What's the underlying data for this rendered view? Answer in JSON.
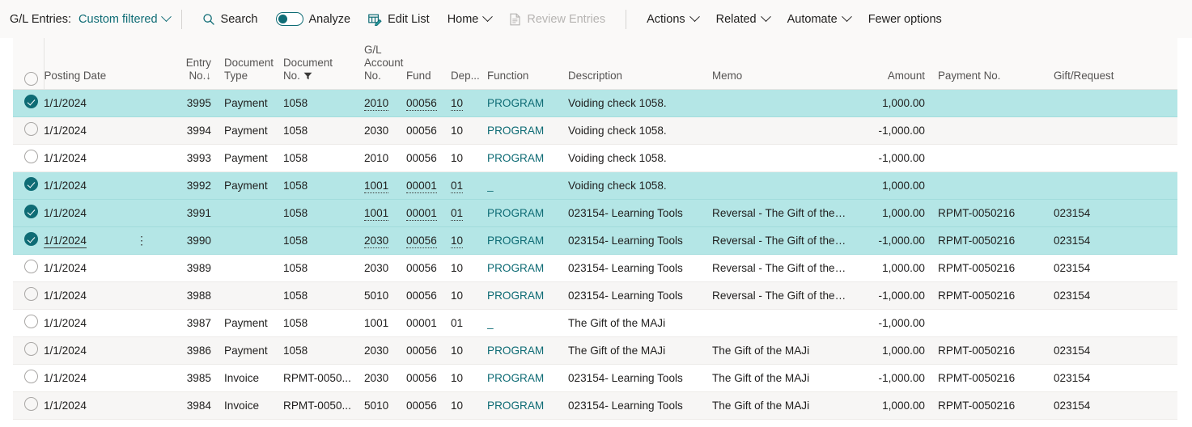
{
  "toolbar": {
    "page_label": "G/L Entries:",
    "filter_label": "Custom filtered",
    "search_label": "Search",
    "analyze_label": "Analyze",
    "analyze_toggle_state": "off",
    "edit_list_label": "Edit List",
    "home_label": "Home",
    "review_entries_label": "Review Entries",
    "review_entries_state": "disabled",
    "actions_label": "Actions",
    "related_label": "Related",
    "automate_label": "Automate",
    "fewer_options_label": "Fewer options",
    "accent_color": "#0f6c75",
    "bar_background": "#faf9f8"
  },
  "table": {
    "selection_color": "#b4e6e6",
    "sort_column": "Entry No.",
    "sort_direction": "descending",
    "filter_column": "Document No.",
    "columns": [
      {
        "key": "posting_date",
        "label": "Posting Date"
      },
      {
        "key": "entry_no",
        "label": "Entry No.",
        "sort_glyph": "↓"
      },
      {
        "key": "document_type",
        "label": "Document\nType"
      },
      {
        "key": "document_no",
        "label": "Document\nNo.",
        "filter_glyph": true
      },
      {
        "key": "gl_account_no",
        "label": "G/L\nAccount\nNo."
      },
      {
        "key": "fund",
        "label": "Fund"
      },
      {
        "key": "dep",
        "label": "Dep..."
      },
      {
        "key": "function",
        "label": "Function"
      },
      {
        "key": "description",
        "label": "Description"
      },
      {
        "key": "memo",
        "label": "Memo"
      },
      {
        "key": "amount",
        "label": "Amount"
      },
      {
        "key": "payment_no",
        "label": "Payment No."
      },
      {
        "key": "gift_request",
        "label": "Gift/Request"
      }
    ],
    "rows": [
      {
        "selected": true,
        "active": false,
        "posting_date": "1/1/2024",
        "entry_no": "3995",
        "document_type": "Payment",
        "document_no": "1058",
        "gl_account_no": "2010",
        "fund": "00056",
        "dep": "10",
        "function": "PROGRAM",
        "description": "Voiding check 1058.",
        "memo": "",
        "amount": "1,000.00",
        "payment_no": "",
        "gift_request": ""
      },
      {
        "selected": false,
        "active": false,
        "posting_date": "1/1/2024",
        "entry_no": "3994",
        "document_type": "Payment",
        "document_no": "1058",
        "gl_account_no": "2030",
        "fund": "00056",
        "dep": "10",
        "function": "PROGRAM",
        "description": "Voiding check 1058.",
        "memo": "",
        "amount": "-1,000.00",
        "payment_no": "",
        "gift_request": ""
      },
      {
        "selected": false,
        "active": false,
        "posting_date": "1/1/2024",
        "entry_no": "3993",
        "document_type": "Payment",
        "document_no": "1058",
        "gl_account_no": "2010",
        "fund": "00056",
        "dep": "10",
        "function": "PROGRAM",
        "description": "Voiding check 1058.",
        "memo": "",
        "amount": "-1,000.00",
        "payment_no": "",
        "gift_request": ""
      },
      {
        "selected": true,
        "active": false,
        "posting_date": "1/1/2024",
        "entry_no": "3992",
        "document_type": "Payment",
        "document_no": "1058",
        "gl_account_no": "1001",
        "fund": "00001",
        "dep": "01",
        "function": "_",
        "description": "Voiding check 1058.",
        "memo": "",
        "amount": "1,000.00",
        "payment_no": "",
        "gift_request": ""
      },
      {
        "selected": true,
        "active": false,
        "posting_date": "1/1/2024",
        "entry_no": "3991",
        "document_type": "",
        "document_no": "1058",
        "gl_account_no": "1001",
        "fund": "00001",
        "dep": "01",
        "function": "PROGRAM",
        "description": "023154- Learning Tools",
        "memo": "Reversal - The Gift of the MAJi",
        "amount": "1,000.00",
        "payment_no": "RPMT-0050216",
        "gift_request": "023154"
      },
      {
        "selected": true,
        "active": true,
        "posting_date": "1/1/2024",
        "entry_no": "3990",
        "document_type": "",
        "document_no": "1058",
        "gl_account_no": "2030",
        "fund": "00056",
        "dep": "10",
        "function": "PROGRAM",
        "description": "023154- Learning Tools",
        "memo": "Reversal - The Gift of the MAJi",
        "amount": "-1,000.00",
        "payment_no": "RPMT-0050216",
        "gift_request": "023154"
      },
      {
        "selected": false,
        "active": false,
        "posting_date": "1/1/2024",
        "entry_no": "3989",
        "document_type": "",
        "document_no": "1058",
        "gl_account_no": "2030",
        "fund": "00056",
        "dep": "10",
        "function": "PROGRAM",
        "description": "023154- Learning Tools",
        "memo": "Reversal - The Gift of the MAJi",
        "amount": "1,000.00",
        "payment_no": "RPMT-0050216",
        "gift_request": "023154"
      },
      {
        "selected": false,
        "active": false,
        "posting_date": "1/1/2024",
        "entry_no": "3988",
        "document_type": "",
        "document_no": "1058",
        "gl_account_no": "5010",
        "fund": "00056",
        "dep": "10",
        "function": "PROGRAM",
        "description": "023154- Learning Tools",
        "memo": "Reversal - The Gift of the MAJi",
        "amount": "-1,000.00",
        "payment_no": "RPMT-0050216",
        "gift_request": "023154"
      },
      {
        "selected": false,
        "active": false,
        "posting_date": "1/1/2024",
        "entry_no": "3987",
        "document_type": "Payment",
        "document_no": "1058",
        "gl_account_no": "1001",
        "fund": "00001",
        "dep": "01",
        "function": "_",
        "description": "The Gift of the MAJi",
        "memo": "",
        "amount": "-1,000.00",
        "payment_no": "",
        "gift_request": ""
      },
      {
        "selected": false,
        "active": false,
        "posting_date": "1/1/2024",
        "entry_no": "3986",
        "document_type": "Payment",
        "document_no": "1058",
        "gl_account_no": "2030",
        "fund": "00056",
        "dep": "10",
        "function": "PROGRAM",
        "description": "The Gift of the MAJi",
        "memo": "The Gift of the MAJi",
        "amount": "1,000.00",
        "payment_no": "RPMT-0050216",
        "gift_request": "023154"
      },
      {
        "selected": false,
        "active": false,
        "posting_date": "1/1/2024",
        "entry_no": "3985",
        "document_type": "Invoice",
        "document_no": "RPMT-0050...",
        "gl_account_no": "2030",
        "fund": "00056",
        "dep": "10",
        "function": "PROGRAM",
        "description": "023154- Learning Tools",
        "memo": "The Gift of the MAJi",
        "amount": "-1,000.00",
        "payment_no": "RPMT-0050216",
        "gift_request": "023154"
      },
      {
        "selected": false,
        "active": false,
        "posting_date": "1/1/2024",
        "entry_no": "3984",
        "document_type": "Invoice",
        "document_no": "RPMT-0050...",
        "gl_account_no": "5010",
        "fund": "00056",
        "dep": "10",
        "function": "PROGRAM",
        "description": "023154- Learning Tools",
        "memo": "The Gift of the MAJi",
        "amount": "1,000.00",
        "payment_no": "RPMT-0050216",
        "gift_request": "023154"
      }
    ]
  }
}
